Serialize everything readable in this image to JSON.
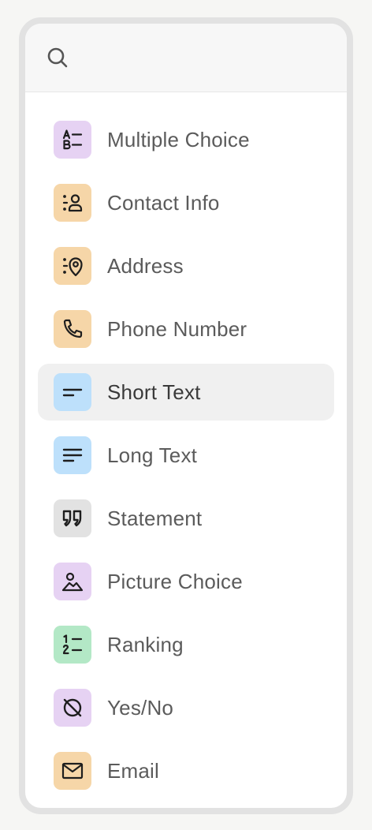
{
  "search": {
    "placeholder": "",
    "value": ""
  },
  "items": [
    {
      "label": "Multiple Choice",
      "icon": "multiple-choice-icon",
      "color": "#e6d2f3",
      "active": false
    },
    {
      "label": "Contact Info",
      "icon": "contact-info-icon",
      "color": "#f6d6a8",
      "active": false
    },
    {
      "label": "Address",
      "icon": "address-icon",
      "color": "#f6d6a8",
      "active": false
    },
    {
      "label": "Phone Number",
      "icon": "phone-icon",
      "color": "#f6d6a8",
      "active": false
    },
    {
      "label": "Short Text",
      "icon": "short-text-icon",
      "color": "#bde0fb",
      "active": true
    },
    {
      "label": "Long Text",
      "icon": "long-text-icon",
      "color": "#bde0fb",
      "active": false
    },
    {
      "label": "Statement",
      "icon": "quote-icon",
      "color": "#e2e2e2",
      "active": false
    },
    {
      "label": "Picture Choice",
      "icon": "picture-choice-icon",
      "color": "#e6d2f3",
      "active": false
    },
    {
      "label": "Ranking",
      "icon": "ranking-icon",
      "color": "#b3e8c6",
      "active": false
    },
    {
      "label": "Yes/No",
      "icon": "yes-no-icon",
      "color": "#e6d2f3",
      "active": false
    },
    {
      "label": "Email",
      "icon": "email-icon",
      "color": "#f6d6a8",
      "active": false
    }
  ]
}
